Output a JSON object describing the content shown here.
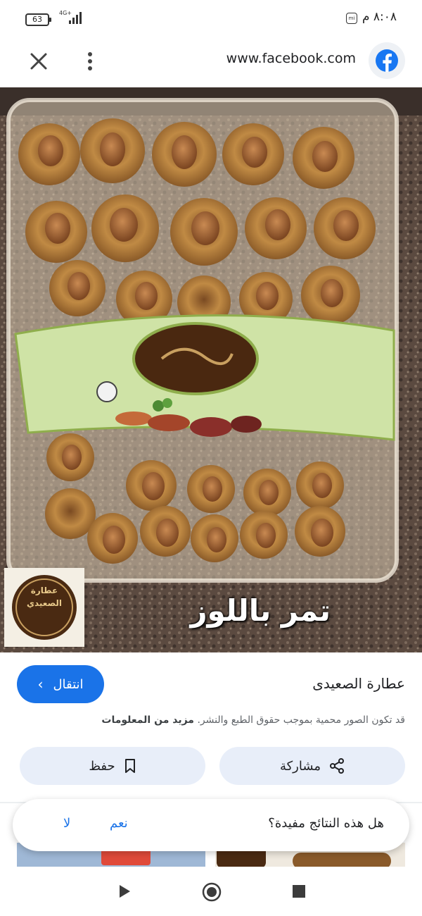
{
  "status_bar": {
    "battery": "63",
    "network": "4G+",
    "time": "٨:٠٨ م",
    "mi_badge": "mi"
  },
  "browser_bar": {
    "url": "www.facebook.com",
    "close_icon": "close-icon",
    "menu_icon": "more-vert-icon",
    "site_icon": "facebook-icon"
  },
  "photo": {
    "caption": "تمر باللوز",
    "logo_text": "عطارة الصعيدي"
  },
  "result": {
    "source_title": "عطارة الصعيدى",
    "visit_label": "انتقال",
    "copyright_text": "قد تكون الصور محمية بموجب حقوق الطبع والنشر.",
    "more_info_label": "مزيد من المعلومات",
    "share_label": "مشاركة",
    "save_label": "حفظ"
  },
  "feedback": {
    "question": "هل هذه النتائج مفيدة؟",
    "yes_label": "نعم",
    "no_label": "لا"
  },
  "colors": {
    "accent": "#1a73e8",
    "chip_bg": "#e8eef9",
    "facebook": "#1877f2"
  }
}
